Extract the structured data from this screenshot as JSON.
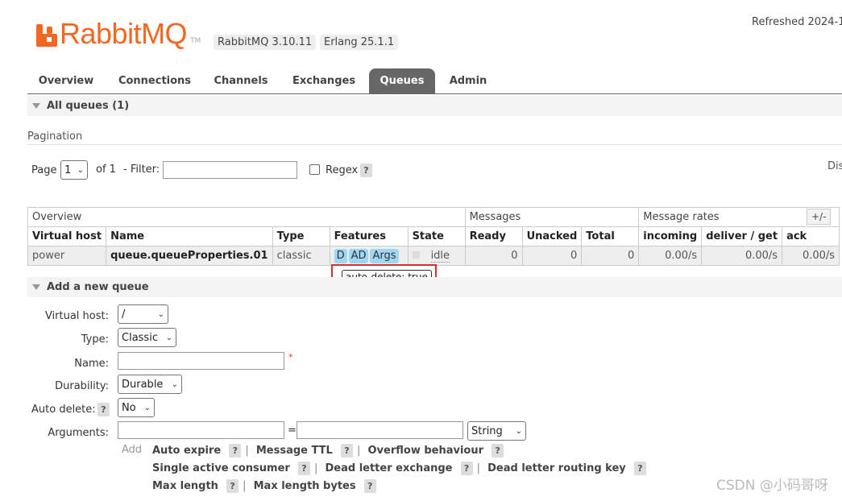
{
  "header": {
    "logo_text": "RabbitMQ",
    "logo_tm": "TM",
    "version": "RabbitMQ 3.10.11",
    "erlang": "Erlang 25.1.1",
    "refreshed": "Refreshed 2024-1"
  },
  "nav": {
    "tabs": [
      {
        "label": "Overview"
      },
      {
        "label": "Connections"
      },
      {
        "label": "Channels"
      },
      {
        "label": "Exchanges"
      },
      {
        "label": "Queues",
        "active": true
      },
      {
        "label": "Admin"
      }
    ]
  },
  "all_queues": {
    "title": "All queues (1)",
    "pagination_label": "Pagination",
    "page_label": "Page",
    "page_value": "1",
    "of_label": "of 1",
    "filter_label": "- Filter:",
    "regex_label": "Regex",
    "help": "?",
    "display_label": "Dis"
  },
  "table": {
    "groups": [
      "Overview",
      "Messages",
      "Message rates"
    ],
    "plus_minus": "+/-",
    "columns": [
      "Virtual host",
      "Name",
      "Type",
      "Features",
      "State",
      "Ready",
      "Unacked",
      "Total",
      "incoming",
      "deliver / get",
      "ack"
    ],
    "row": {
      "vhost": "power",
      "name": "queue.queueProperties.01",
      "type": "classic",
      "features": [
        "D",
        "AD",
        "Args"
      ],
      "state": "idle",
      "ready": "0",
      "unacked": "0",
      "total": "0",
      "incoming": "0.00/s",
      "deliver_get": "0.00/s",
      "ack": "0.00/s"
    },
    "tooltip": "auto-delete: true"
  },
  "add_queue": {
    "title": "Add a new queue",
    "virtual_host_label": "Virtual host:",
    "virtual_host_value": "/",
    "type_label": "Type:",
    "type_value": "Classic",
    "name_label": "Name:",
    "required_mark": "*",
    "durability_label": "Durability:",
    "durability_value": "Durable",
    "auto_delete_label": "Auto delete:",
    "auto_delete_value": "No",
    "arguments_label": "Arguments:",
    "equals": "=",
    "arg_type_value": "String",
    "add_label": "Add",
    "options_row1": [
      "Auto expire",
      "Message TTL",
      "Overflow behaviour"
    ],
    "options_row2": [
      "Single active consumer",
      "Dead letter exchange",
      "Dead letter routing key"
    ],
    "options_row3": [
      "Max length",
      "Max length bytes"
    ]
  },
  "watermark": "CSDN @小码哥呀"
}
